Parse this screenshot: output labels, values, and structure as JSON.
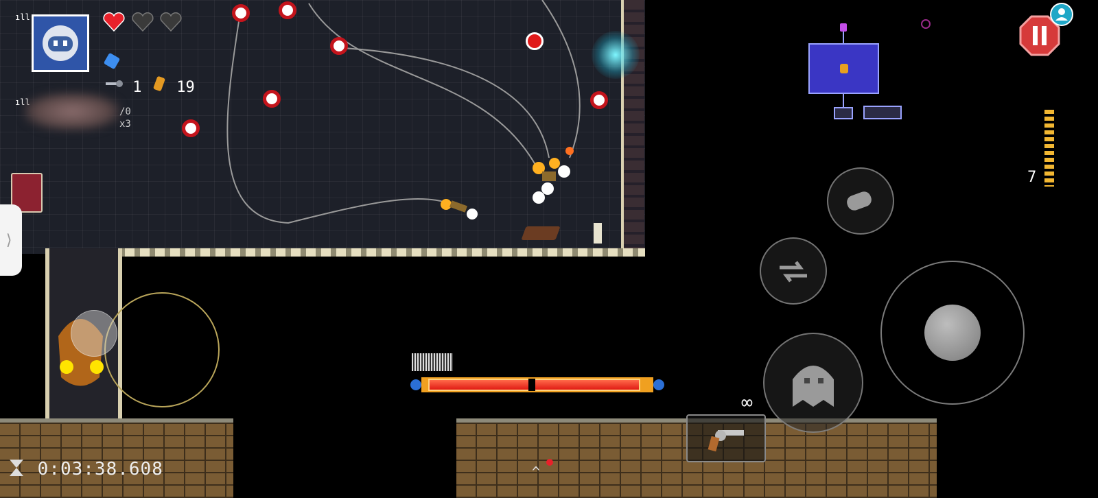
{
  "hud": {
    "signal_top": "ıll",
    "signal_second": "ıll",
    "keys_count": "1",
    "shells_count": "19",
    "stat_line1": "/0",
    "stat_line2": "x3",
    "side_tab_arrow": "⟩"
  },
  "hearts": [
    {
      "state": "full",
      "color": "#e8202a"
    },
    {
      "state": "empty",
      "color": "#3a3a3a"
    },
    {
      "state": "empty",
      "color": "#3a3a3a"
    }
  ],
  "weapon": {
    "ammo_infinite": "∞",
    "clip_count": "7",
    "gun_icon": "revolver-icon"
  },
  "timer": {
    "text": "0:03:38.608",
    "icon": "hourglass-icon"
  },
  "boss": {
    "health_fraction": 0.98
  },
  "nav": {
    "bottom_arrow": "^"
  },
  "colors": {
    "boss_bar": "#e01b14",
    "minimap_room": "#3a36c4",
    "pause_button": "#d63a3a",
    "ammo": "#f2b732"
  }
}
